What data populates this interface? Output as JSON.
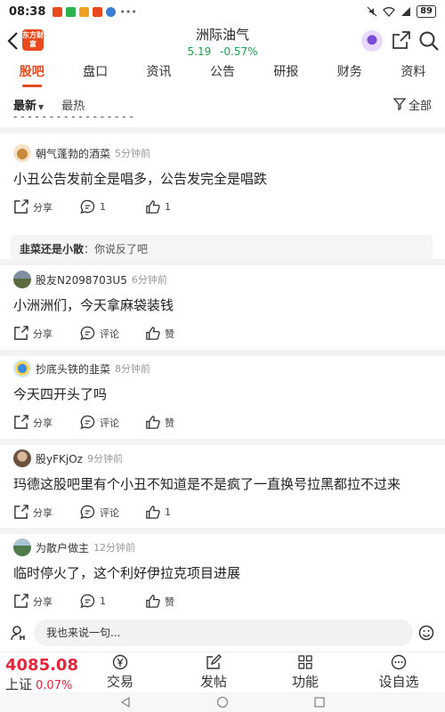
{
  "status": {
    "time": "08:38",
    "battery": "89"
  },
  "header": {
    "logo_text": "东方财富",
    "title": "洲际油气",
    "price": "5.19",
    "change": "-0.57%",
    "colors": {
      "accent": "#e8491d",
      "down": "#1aa34a"
    }
  },
  "tabs": [
    "股吧",
    "盘口",
    "资讯",
    "公告",
    "研报",
    "财务",
    "资料"
  ],
  "sort": {
    "latest": "最新",
    "hot": "最热",
    "filter": "全部"
  },
  "posts": [
    {
      "user": "朝气蓬勃的酒菜",
      "time": "5分钟前",
      "text": "小丑公告发前全是唱多，公告发完全是唱跌",
      "share": "分享",
      "comment": "1",
      "like": "1",
      "reply": {
        "user": "韭菜还是小散",
        "text": "：你说反了吧"
      }
    },
    {
      "user": "股友N2098703U5",
      "time": "6分钟前",
      "text": "小洲洲们，今天拿麻袋装钱",
      "share": "分享",
      "comment": "评论",
      "like": "赞"
    },
    {
      "user": "抄底头铁的韭菜",
      "time": "8分钟前",
      "text": "今天四开头了吗",
      "share": "分享",
      "comment": "评论",
      "like": "赞"
    },
    {
      "user": "股yFKjOz",
      "time": "9分钟前",
      "text": "玛德这股吧里有个小丑不知道是不是疯了一直换号拉黑都拉不过来",
      "share": "分享",
      "comment": "评论",
      "like": "1"
    },
    {
      "user": "为散户做主",
      "time": "12分钟前",
      "text": "临时停火了，这个利好伊拉克项目进展",
      "share": "分享",
      "comment": "1",
      "like": "赞"
    }
  ],
  "input": {
    "placeholder": "我也来说一句..."
  },
  "bottom": {
    "index_value": "4085.08",
    "index_name": "上证",
    "index_change": "0.07%",
    "nav": [
      "交易",
      "发帖",
      "功能",
      "设自选"
    ]
  }
}
